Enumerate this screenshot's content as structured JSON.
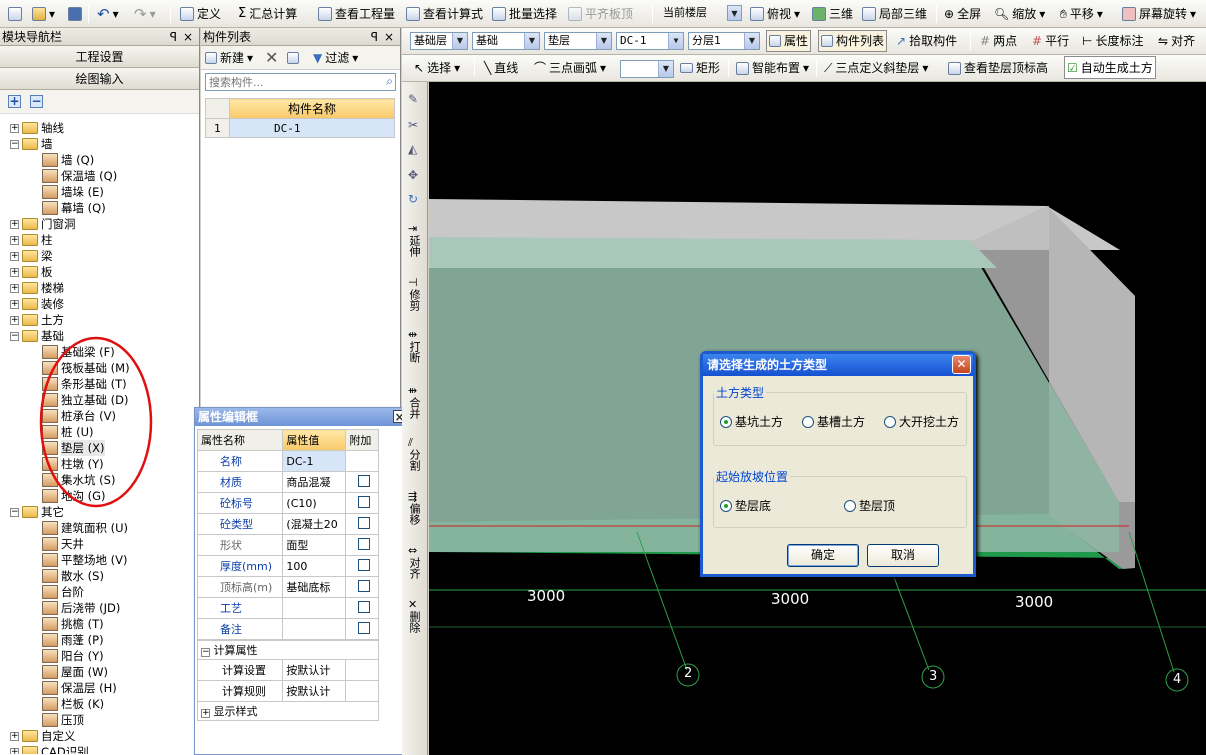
{
  "toolbar1": {
    "define": "定义",
    "sum": "汇总计算",
    "view_qty": "查看工程量",
    "view_formula": "查看计算式",
    "batch_select": "批量选择",
    "align_bottom": "平齐板顶",
    "floor_select": "当前楼层",
    "top_view": "俯视",
    "three_d": "三维",
    "local_3d": "局部三维",
    "fullscreen": "全屏",
    "zoom": "缩放",
    "pan": "平移",
    "rotate": "屏幕旋转"
  },
  "toolbar2": {
    "layer_type": "基础层",
    "category": "基础",
    "subtype": "垫层",
    "component": "DC-1",
    "sublayer": "分层1",
    "props": "属性",
    "comp_list": "构件列表",
    "pick": "拾取构件",
    "two_point": "两点",
    "parallel": "平行",
    "length_dim": "长度标注",
    "align": "对齐"
  },
  "toolbar3": {
    "select": "选择",
    "line": "直线",
    "arc": "三点画弧",
    "rect": "矩形",
    "smart": "智能布置",
    "slope": "三点定义斜垫层",
    "view_top": "查看垫层顶标高",
    "auto_earth": "自动生成土方"
  },
  "nav": {
    "title": "模块导航栏",
    "project_settings": "工程设置",
    "drawing_input": "绘图输入",
    "items": [
      {
        "label": "轴线",
        "level": 0,
        "exp": "+"
      },
      {
        "label": "墙",
        "level": 0,
        "exp": "-"
      },
      {
        "label": "墙 (Q)",
        "level": 1
      },
      {
        "label": "保温墙 (Q)",
        "level": 1
      },
      {
        "label": "墙垛 (E)",
        "level": 1
      },
      {
        "label": "幕墙 (Q)",
        "level": 1
      },
      {
        "label": "门窗洞",
        "level": 0,
        "exp": "+"
      },
      {
        "label": "柱",
        "level": 0,
        "exp": "+"
      },
      {
        "label": "梁",
        "level": 0,
        "exp": "+"
      },
      {
        "label": "板",
        "level": 0,
        "exp": "+"
      },
      {
        "label": "楼梯",
        "level": 0,
        "exp": "+"
      },
      {
        "label": "装修",
        "level": 0,
        "exp": "+"
      },
      {
        "label": "土方",
        "level": 0,
        "exp": "+"
      },
      {
        "label": "基础",
        "level": 0,
        "exp": "-"
      },
      {
        "label": "基础梁 (F)",
        "level": 1
      },
      {
        "label": "筏板基础 (M)",
        "level": 1
      },
      {
        "label": "条形基础 (T)",
        "level": 1
      },
      {
        "label": "独立基础 (D)",
        "level": 1
      },
      {
        "label": "桩承台 (V)",
        "level": 1
      },
      {
        "label": "桩 (U)",
        "level": 1
      },
      {
        "label": "垫层 (X)",
        "level": 1,
        "sel": true
      },
      {
        "label": "柱墩 (Y)",
        "level": 1
      },
      {
        "label": "集水坑 (S)",
        "level": 1
      },
      {
        "label": "地沟 (G)",
        "level": 1
      },
      {
        "label": "其它",
        "level": 0,
        "exp": "-"
      },
      {
        "label": "建筑面积 (U)",
        "level": 1
      },
      {
        "label": "天井",
        "level": 1
      },
      {
        "label": "平整场地 (V)",
        "level": 1
      },
      {
        "label": "散水 (S)",
        "level": 1
      },
      {
        "label": "台阶",
        "level": 1
      },
      {
        "label": "后浇带 (JD)",
        "level": 1
      },
      {
        "label": "挑檐 (T)",
        "level": 1
      },
      {
        "label": "雨蓬 (P)",
        "level": 1
      },
      {
        "label": "阳台 (Y)",
        "level": 1
      },
      {
        "label": "屋面 (W)",
        "level": 1
      },
      {
        "label": "保温层 (H)",
        "level": 1
      },
      {
        "label": "栏板 (K)",
        "level": 1
      },
      {
        "label": "压顶",
        "level": 1
      },
      {
        "label": "自定义",
        "level": 0,
        "exp": "+"
      },
      {
        "label": "CAD识别",
        "level": 0,
        "exp": "+"
      }
    ]
  },
  "complist": {
    "title": "构件列表",
    "new": "新建",
    "filter": "过滤",
    "search_placeholder": "搜索构件...",
    "col_name": "构件名称",
    "rows": [
      {
        "no": "1",
        "name": "DC-1"
      }
    ]
  },
  "props": {
    "title": "属性编辑框",
    "col_name": "属性名称",
    "col_value": "属性值",
    "col_extra": "附加",
    "rows": [
      {
        "name": "名称",
        "value": "DC-1",
        "cb": false,
        "blue": true
      },
      {
        "name": "材质",
        "value": "商品混凝",
        "cb": true,
        "blue": true
      },
      {
        "name": "砼标号",
        "value": "(C10)",
        "cb": true,
        "blue": true
      },
      {
        "name": "砼类型",
        "value": "(混凝土20",
        "cb": true,
        "blue": true
      },
      {
        "name": "形状",
        "value": "面型",
        "cb": true,
        "blue": false
      },
      {
        "name": "厚度(mm)",
        "value": "100",
        "cb": true,
        "blue": true
      },
      {
        "name": "顶标高(m)",
        "value": "基础底标",
        "cb": true,
        "blue": false
      },
      {
        "name": "工艺",
        "value": "",
        "cb": true,
        "blue": true
      },
      {
        "name": "备注",
        "value": "",
        "cb": true,
        "blue": true
      }
    ],
    "group_calc": "计算属性",
    "calc_settings": "计算设置",
    "calc_settings_val": "按默认计",
    "calc_rules": "计算规则",
    "calc_rules_val": "按默认计",
    "display_style": "显示样式"
  },
  "vtools": {
    "extend": "延伸",
    "trim": "修剪",
    "break": "打断",
    "merge": "合并",
    "split": "分割",
    "offset": "偏移",
    "align": "对齐",
    "delete": "删除"
  },
  "canvas": {
    "dim1": "3000",
    "dim2": "3000",
    "dim3": "3000",
    "axis2": "2",
    "axis3": "3",
    "axis4": "4"
  },
  "dialog": {
    "title": "请选择生成的土方类型",
    "group1": "土方类型",
    "opt_pit": "基坑土方",
    "opt_trench": "基槽土方",
    "opt_open": "大开挖土方",
    "group2": "起始放坡位置",
    "opt_bottom": "垫层底",
    "opt_top": "垫层顶",
    "ok": "确定",
    "cancel": "取消"
  }
}
